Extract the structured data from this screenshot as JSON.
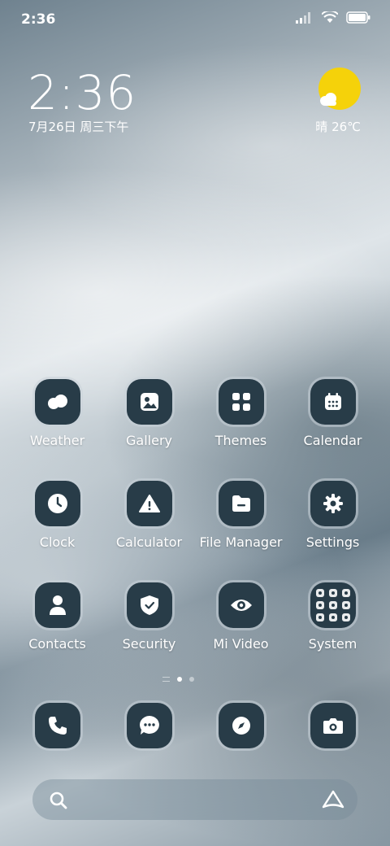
{
  "status_bar": {
    "time": "2:36"
  },
  "clock_widget": {
    "time": "2:36",
    "date": "7月26日 周三下午"
  },
  "weather_widget": {
    "condition": "晴",
    "temperature": "26℃"
  },
  "apps": [
    {
      "label": "Weather",
      "icon": "weather-icon"
    },
    {
      "label": "Gallery",
      "icon": "gallery-icon"
    },
    {
      "label": "Themes",
      "icon": "themes-icon"
    },
    {
      "label": "Calendar",
      "icon": "calendar-icon"
    },
    {
      "label": "Clock",
      "icon": "clock-icon"
    },
    {
      "label": "Calculator",
      "icon": "calculator-icon"
    },
    {
      "label": "File Manager",
      "icon": "file-manager-icon"
    },
    {
      "label": "Settings",
      "icon": "settings-icon"
    },
    {
      "label": "Contacts",
      "icon": "contacts-icon"
    },
    {
      "label": "Security",
      "icon": "security-icon"
    },
    {
      "label": "Mi Video",
      "icon": "mi-video-icon"
    },
    {
      "label": "System",
      "icon": "system-folder-icon"
    }
  ],
  "dock": [
    {
      "icon": "phone-icon"
    },
    {
      "icon": "messages-icon"
    },
    {
      "icon": "browser-icon"
    },
    {
      "icon": "camera-icon"
    }
  ],
  "page_indicator": {
    "pages": 2,
    "active": 1
  },
  "colors": {
    "tile": "#283c48",
    "sun": "#f5d20a",
    "text": "#ffffff"
  }
}
